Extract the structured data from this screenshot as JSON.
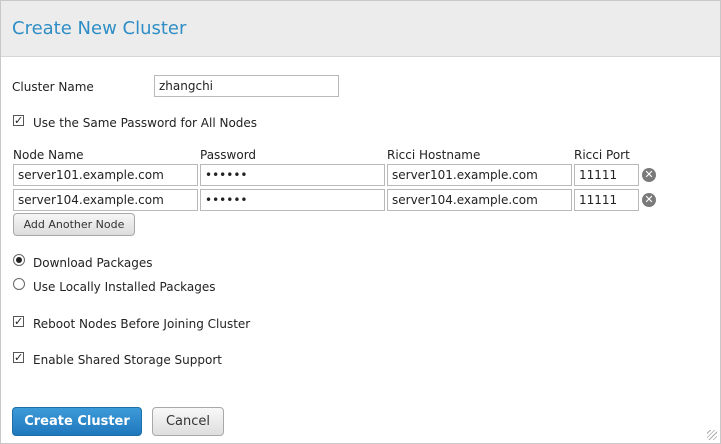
{
  "dialog": {
    "title": "Create New Cluster"
  },
  "cluster_name": {
    "label": "Cluster Name",
    "value": "zhangchi"
  },
  "same_password": {
    "label": "Use the Same Password for All Nodes",
    "checked": true
  },
  "nodes_table": {
    "columns": [
      "Node Name",
      "Password",
      "Ricci Hostname",
      "Ricci Port"
    ],
    "rows": [
      {
        "node_name": "server101.example.com",
        "password": "••••••",
        "ricci_hostname": "server101.example.com",
        "ricci_port": "11111"
      },
      {
        "node_name": "server104.example.com",
        "password": "••••••",
        "ricci_hostname": "server104.example.com",
        "ricci_port": "11111"
      }
    ],
    "add_node_label": "Add Another Node",
    "remove_icon": "remove-circle-icon"
  },
  "packages": {
    "options": [
      {
        "label": "Download Packages",
        "selected": true
      },
      {
        "label": "Use Locally Installed Packages",
        "selected": false
      }
    ]
  },
  "reboot_nodes": {
    "label": "Reboot Nodes Before Joining Cluster",
    "checked": true
  },
  "shared_storage": {
    "label": "Enable Shared Storage Support",
    "checked": true
  },
  "actions": {
    "create_label": "Create Cluster",
    "cancel_label": "Cancel"
  },
  "colors": {
    "title": "#2e8ec5",
    "primary_button": "#1f78bd"
  }
}
